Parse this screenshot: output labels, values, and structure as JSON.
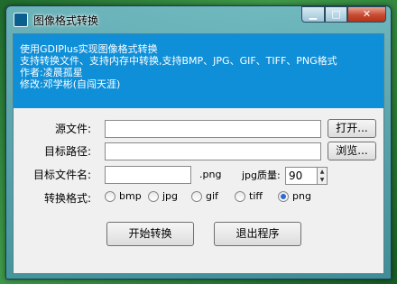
{
  "window": {
    "title": "图像格式转换"
  },
  "titlebar": {
    "min_glyph": "▁",
    "max_glyph": "□",
    "close_glyph": "✕"
  },
  "banner": {
    "line1": "使用GDIPlus实现图像格式转换",
    "line2": "支持转换文件、支持内存中转换,支持BMP、JPG、GIF、TIFF、PNG格式",
    "line3": "作者:凌晨孤星",
    "line4": "修改:邓学彬(自闯天涯)"
  },
  "form": {
    "source_label": "源文件:",
    "source_value": "",
    "open_button": "打开...",
    "target_label": "目标路径:",
    "target_value": "",
    "browse_button": "浏览...",
    "filename_label": "目标文件名:",
    "filename_value": "",
    "ext_label": ".png",
    "quality_label": "jpg质量:",
    "quality_value": "90",
    "format_label": "转换格式:",
    "formats": [
      "bmp",
      "jpg",
      "gif",
      "tiff",
      "png"
    ],
    "selected_format": "png"
  },
  "actions": {
    "convert_button": "开始转换",
    "exit_button": "退出程序"
  }
}
